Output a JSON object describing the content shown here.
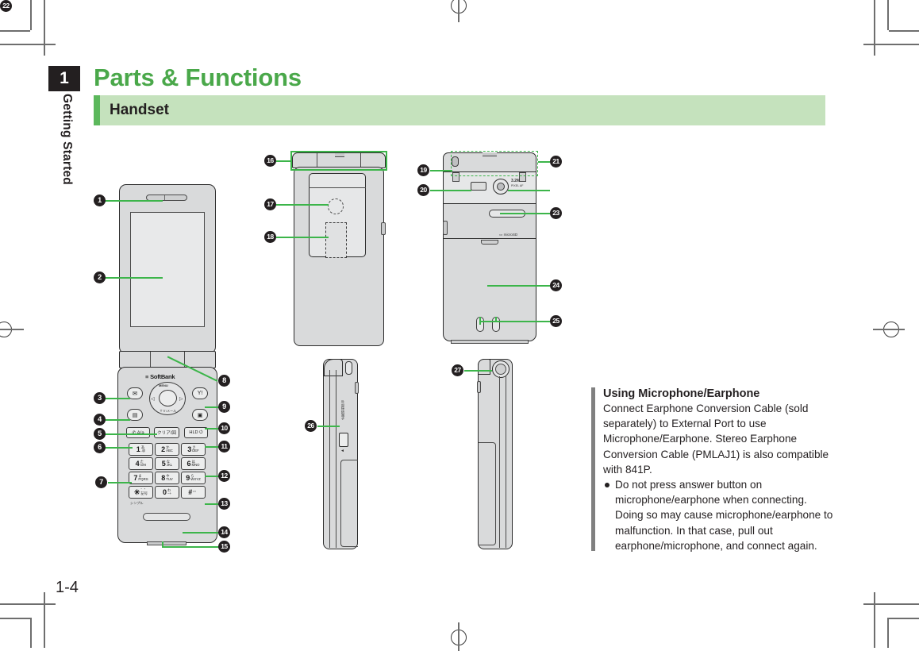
{
  "document": {
    "chapter_number": "1",
    "chapter_name": "Getting Started",
    "title": "Parts & Functions",
    "section": "Handset",
    "page_number": "1-4"
  },
  "colors": {
    "accent_green": "#4aa84a",
    "lead_green": "#3cb54a",
    "band_green": "#c5e2bd",
    "bar_green": "#5cb85c",
    "ink": "#231f20",
    "rule_gray": "#808080"
  },
  "note": {
    "heading": "Using Microphone/Earphone",
    "body": "Connect Earphone Conversion Cable (sold separately) to External Port to use Microphone/Earphone. Stereo Earphone Conversion Cable (PMLAJ1) is also compatible with 841P.",
    "bullets": [
      "Do not press answer button on microphone/earphone when connecting. Doing so may cause microphone/earphone to malfunction. In that case, pull out earphone/microphone, and connect again."
    ]
  },
  "callouts": {
    "front_view": [
      "1",
      "2",
      "3",
      "4",
      "5",
      "6",
      "7",
      "8",
      "9",
      "10",
      "11",
      "12",
      "13",
      "14",
      "15"
    ],
    "closed_front_view": [
      "16",
      "17",
      "18"
    ],
    "rear_view": [
      "19",
      "20",
      "21",
      "22",
      "23",
      "24",
      "25"
    ],
    "left_side_view": [
      "26"
    ],
    "right_side_view": [
      "27"
    ]
  },
  "handset_labels": {
    "brand": "SoftBank",
    "camera": "3.2M",
    "camera_sub": "PIXEL AF",
    "microsd": "microSD",
    "simple_mode": "シンプル",
    "external_port": "外部接続端子",
    "keys": [
      {
        "main": "1",
        "sub": "あ\\n.@"
      },
      {
        "main": "2",
        "sub": "か\\nABC"
      },
      {
        "main": "3",
        "sub": "さ\\nDEF"
      },
      {
        "main": "4",
        "sub": "た\\nGHI"
      },
      {
        "main": "5",
        "sub": "な\\nJKL"
      },
      {
        "main": "6",
        "sub": "は\\nMNO"
      },
      {
        "main": "7",
        "sub": "ま\\nPQRS"
      },
      {
        "main": "8",
        "sub": "や\\nTUV"
      },
      {
        "main": "9",
        "sub": "ら\\nWXYZ"
      },
      {
        "main": "✳",
        "sub": "わ\\n記号"
      },
      {
        "main": "0",
        "sub": "わ\\n−+"
      },
      {
        "main": "#",
        "sub": "、。\\n゛゜"
      }
    ],
    "function_keys": [
      {
        "label": "✉",
        "name": "mail-key"
      },
      {
        "label": "MENU",
        "name": "center-key"
      },
      {
        "label": "Y!",
        "name": "yahoo-key"
      },
      {
        "label": "☎",
        "name": "tv-key"
      },
      {
        "label": "📷",
        "name": "camera-key"
      },
      {
        "label": "A/a",
        "name": "call-key"
      },
      {
        "label": "クリア/回",
        "name": "clear-key"
      },
      {
        "label": "HLD",
        "name": "power-key"
      }
    ]
  }
}
